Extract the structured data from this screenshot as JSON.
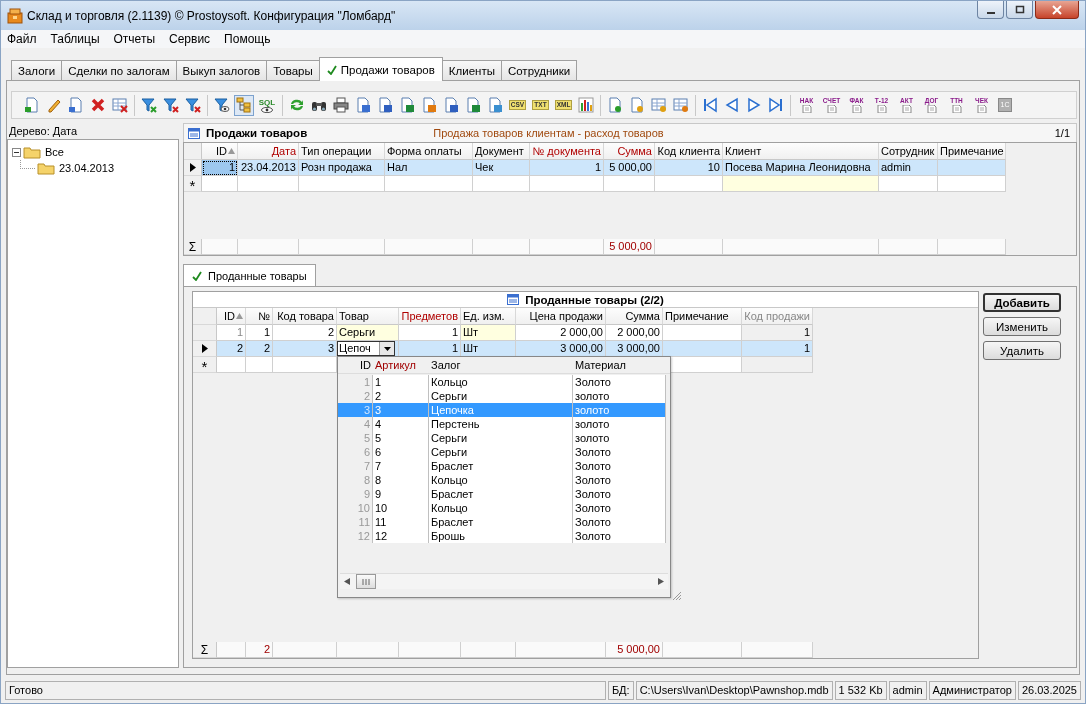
{
  "window": {
    "title": "Склад и торговля (2.1139) © Prostoysoft. Конфигурация \"Ломбард\""
  },
  "menu": [
    "Файл",
    "Таблицы",
    "Отчеты",
    "Сервис",
    "Помощь"
  ],
  "tabs": [
    {
      "label": "Залоги",
      "selected": false
    },
    {
      "label": "Сделки по залогам",
      "selected": false
    },
    {
      "label": "Выкуп залогов",
      "selected": false
    },
    {
      "label": "Товары",
      "selected": false
    },
    {
      "label": "Продажи товаров",
      "selected": true
    },
    {
      "label": "Клиенты",
      "selected": false
    },
    {
      "label": "Сотрудники",
      "selected": false
    }
  ],
  "toolbar": {
    "sql_label": "SQL",
    "tree_pressed": true,
    "export_labels": [
      "CSV",
      "TXT",
      "XML"
    ],
    "document_labels": [
      "НАК",
      "СЧЕТ",
      "ФАК",
      "Т-12",
      "АКТ",
      "ДОГ",
      "ТТН",
      "ЧЕК"
    ],
    "accounting_label": "1С"
  },
  "tree": {
    "title": "Дерево: Дата",
    "items": [
      {
        "label": "Все",
        "expanded": true,
        "children": [
          {
            "label": "23.04.2013"
          }
        ]
      }
    ]
  },
  "sales": {
    "title": "Продажи товаров",
    "subtitle": "Продажа товаров клиентам - расход товаров",
    "counter": "1/1",
    "new_row_symbol": "*",
    "totals_symbol": "Σ",
    "columns": [
      {
        "label": "ID",
        "sorted": true,
        "accent": false,
        "numeric": true,
        "lookup": false,
        "readonly": false
      },
      {
        "label": "Дата",
        "sorted": false,
        "accent": true,
        "numeric": true,
        "lookup": false,
        "readonly": false
      },
      {
        "label": "Тип операции",
        "sorted": false,
        "accent": false,
        "numeric": false,
        "lookup": false,
        "readonly": false
      },
      {
        "label": "Форма оплаты",
        "sorted": false,
        "accent": false,
        "numeric": false,
        "lookup": false,
        "readonly": false
      },
      {
        "label": "Документ",
        "sorted": false,
        "accent": false,
        "numeric": false,
        "lookup": false,
        "readonly": false
      },
      {
        "label": "№ документа",
        "sorted": false,
        "accent": true,
        "numeric": true,
        "lookup": false,
        "readonly": false
      },
      {
        "label": "Сумма",
        "sorted": false,
        "accent": true,
        "numeric": true,
        "lookup": false,
        "readonly": false,
        "total": "5 000,00"
      },
      {
        "label": "Код клиента",
        "sorted": false,
        "accent": false,
        "numeric": true,
        "lookup": false,
        "readonly": false
      },
      {
        "label": "Клиент",
        "sorted": false,
        "accent": false,
        "numeric": false,
        "lookup": true,
        "readonly": false
      },
      {
        "label": "Сотрудник",
        "sorted": false,
        "accent": false,
        "numeric": false,
        "lookup": false,
        "readonly": false
      },
      {
        "label": "Примечание",
        "sorted": false,
        "accent": false,
        "numeric": false,
        "lookup": false,
        "readonly": false
      }
    ],
    "rows": [
      {
        "selected": true,
        "current": true,
        "cells": [
          {
            "value": "1",
            "focused": true
          },
          "23.04.2013",
          "Розн продажа",
          "Нал",
          "Чек",
          "1",
          "5 000,00",
          "10",
          "Посева Марина Леонидовна",
          "admin",
          null
        ]
      }
    ]
  },
  "items_tab": {
    "label": "Проданные товары",
    "selected": true
  },
  "items": {
    "title": "Проданные товары (2/2)",
    "new_row_symbol": "*",
    "totals_symbol": "Σ",
    "columns": [
      {
        "label": "ID",
        "sorted": true,
        "accent": false,
        "numeric": true,
        "lookup": false,
        "readonly": false
      },
      {
        "label": "№",
        "sorted": false,
        "accent": false,
        "numeric": true,
        "lookup": false,
        "readonly": false,
        "total": "2"
      },
      {
        "label": "Код товара",
        "sorted": false,
        "accent": false,
        "numeric": true,
        "lookup": false,
        "readonly": false
      },
      {
        "label": "Товар",
        "sorted": false,
        "accent": false,
        "numeric": false,
        "lookup": true,
        "readonly": false
      },
      {
        "label": "Предметов",
        "sorted": false,
        "accent": true,
        "numeric": true,
        "lookup": false,
        "readonly": false
      },
      {
        "label": "Ед. изм.",
        "sorted": false,
        "accent": false,
        "numeric": false,
        "lookup": true,
        "readonly": false
      },
      {
        "label": "Цена продажи",
        "sorted": false,
        "accent": false,
        "numeric": true,
        "lookup": false,
        "readonly": false
      },
      {
        "label": "Сумма",
        "sorted": false,
        "accent": false,
        "numeric": true,
        "lookup": false,
        "readonly": false,
        "total": "5 000,00"
      },
      {
        "label": "Примечание",
        "sorted": false,
        "accent": false,
        "numeric": false,
        "lookup": false,
        "readonly": false
      },
      {
        "label": "Код продажи",
        "sorted": false,
        "accent": false,
        "numeric": true,
        "lookup": false,
        "readonly": true
      }
    ],
    "rows": [
      {
        "selected": false,
        "current": false,
        "cells": [
          {
            "value": "1",
            "muted": true
          },
          "1",
          "2",
          "Серьги",
          "1",
          "Шт",
          "2 000,00",
          "2 000,00",
          null,
          "1"
        ]
      },
      {
        "selected": true,
        "current": true,
        "cells": [
          "2",
          "2",
          "3",
          {
            "value": "Цепоч",
            "editing": true
          },
          "1",
          "Шт",
          "3 000,00",
          "3 000,00",
          null,
          "1"
        ]
      }
    ],
    "dropdown": {
      "columns": [
        {
          "label": "ID",
          "accent": false,
          "muted": true
        },
        {
          "label": "Артикул",
          "accent": true,
          "muted": false
        },
        {
          "label": "Залог",
          "accent": false,
          "muted": false
        },
        {
          "label": "Материал",
          "accent": false,
          "muted": false
        }
      ],
      "rows": [
        {
          "selected": false,
          "cells": [
            "1",
            "1",
            "Кольцо",
            "Золото"
          ]
        },
        {
          "selected": false,
          "cells": [
            "2",
            "2",
            "Серьги",
            "золото"
          ]
        },
        {
          "selected": true,
          "cells": [
            "3",
            "3",
            "Цепочка",
            "золото"
          ]
        },
        {
          "selected": false,
          "cells": [
            "4",
            "4",
            "Перстень",
            "золото"
          ]
        },
        {
          "selected": false,
          "cells": [
            "5",
            "5",
            "Серьги",
            "золото"
          ]
        },
        {
          "selected": false,
          "cells": [
            "6",
            "6",
            "Серьги",
            "Золото"
          ]
        },
        {
          "selected": false,
          "cells": [
            "7",
            "7",
            "Браслет",
            "Золото"
          ]
        },
        {
          "selected": false,
          "cells": [
            "8",
            "8",
            "Кольцо",
            "Золото"
          ]
        },
        {
          "selected": false,
          "cells": [
            "9",
            "9",
            "Браслет",
            "Золото"
          ]
        },
        {
          "selected": false,
          "cells": [
            "10",
            "10",
            "Кольцо",
            "Золото"
          ]
        },
        {
          "selected": false,
          "cells": [
            "11",
            "11",
            "Браслет",
            "Золото"
          ]
        },
        {
          "selected": false,
          "cells": [
            "12",
            "12",
            "Брошь",
            "Золото"
          ]
        }
      ]
    }
  },
  "buttons": [
    {
      "label": "Добавить",
      "default": true
    },
    {
      "label": "Изменить",
      "default": false
    },
    {
      "label": "Удалить",
      "default": false
    }
  ],
  "status_bar": {
    "message": "Готово",
    "db_label": "БД:",
    "path": "C:\\Users\\Ivan\\Desktop\\Pawnshop.mdb",
    "size": "1 532 Kb",
    "user": "admin",
    "role": "Администратор",
    "date": "26.03.2025"
  }
}
